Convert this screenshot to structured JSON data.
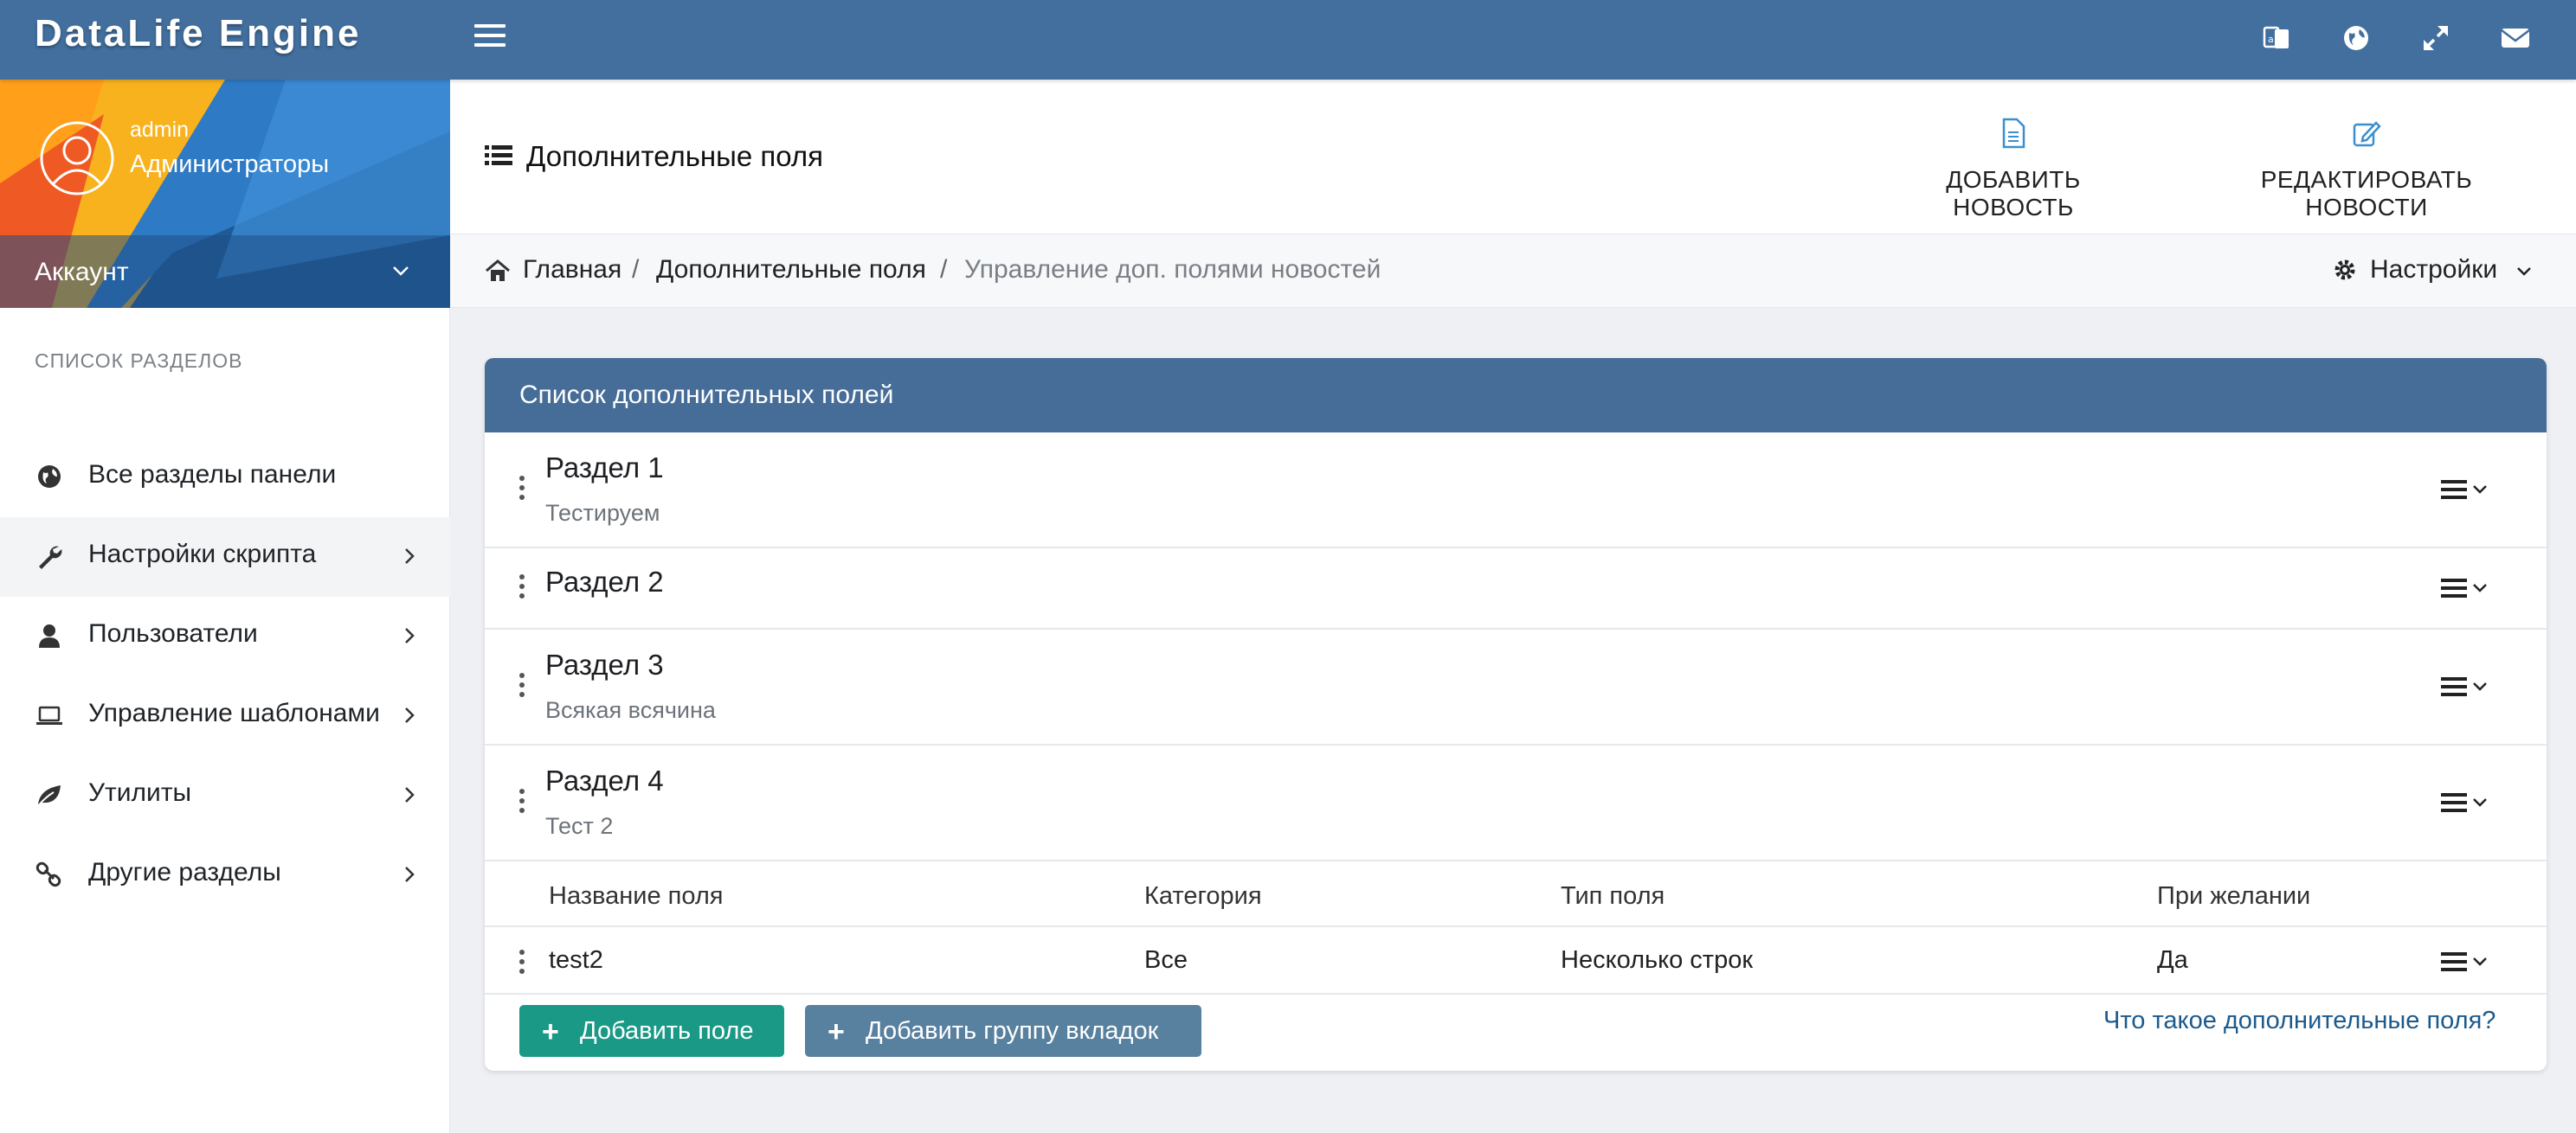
{
  "app": {
    "title": "DataLife Engine"
  },
  "navbar": {
    "icons": [
      "menu-icon",
      "language-icon",
      "globe-icon",
      "fullscreen-icon",
      "mail-icon"
    ]
  },
  "user": {
    "name": "admin",
    "group": "Администраторы",
    "account_label": "Аккаунт"
  },
  "sidebar": {
    "heading": "СПИСОК РАЗДЕЛОВ",
    "items": [
      {
        "label": "Все разделы панели",
        "icon": "globe-icon",
        "has_arrow": false
      },
      {
        "label": "Настройки скрипта",
        "icon": "wrench-icon",
        "has_arrow": true
      },
      {
        "label": "Пользователи",
        "icon": "user-icon",
        "has_arrow": true
      },
      {
        "label": "Управление шаблонами",
        "icon": "laptop-icon",
        "has_arrow": true
      },
      {
        "label": "Утилиты",
        "icon": "leaf-icon",
        "has_arrow": true
      },
      {
        "label": "Другие разделы",
        "icon": "link-icon",
        "has_arrow": true
      }
    ]
  },
  "header": {
    "title": "Дополнительные поля",
    "add_news": "ДОБАВИТЬ НОВОСТЬ",
    "edit_news": "РЕДАКТИРОВАТЬ НОВОСТИ"
  },
  "breadcrumb": {
    "home": "Главная",
    "separator": "/",
    "parent": "Дополнительные поля",
    "current": "Управление доп. полями новостей",
    "settings": "Настройки"
  },
  "panel": {
    "title": "Список дополнительных полей",
    "sections": [
      {
        "title": "Раздел 1",
        "subtitle": "Тестируем"
      },
      {
        "title": "Раздел 2",
        "subtitle": ""
      },
      {
        "title": "Раздел 3",
        "subtitle": "Всякая всячина"
      },
      {
        "title": "Раздел 4",
        "subtitle": "Тест 2"
      }
    ],
    "table": {
      "headers": [
        "Название поля",
        "Категория",
        "Тип поля",
        "При желании"
      ],
      "rows": [
        {
          "name": "test2",
          "category": "Все",
          "type": "Несколько строк",
          "optional": "Да"
        }
      ]
    },
    "add_field": "Добавить поле",
    "add_tab_group": "Добавить группу вкладок",
    "plus": "+",
    "help_link": "Что такое дополнительные поля?"
  },
  "colors": {
    "navbar": "#426f9e",
    "panel_header": "#466d98",
    "btn_green": "#1a9a86",
    "btn_blue": "#58809f",
    "link": "#1c5a8c",
    "accent_icon": "#3a8fd0"
  }
}
